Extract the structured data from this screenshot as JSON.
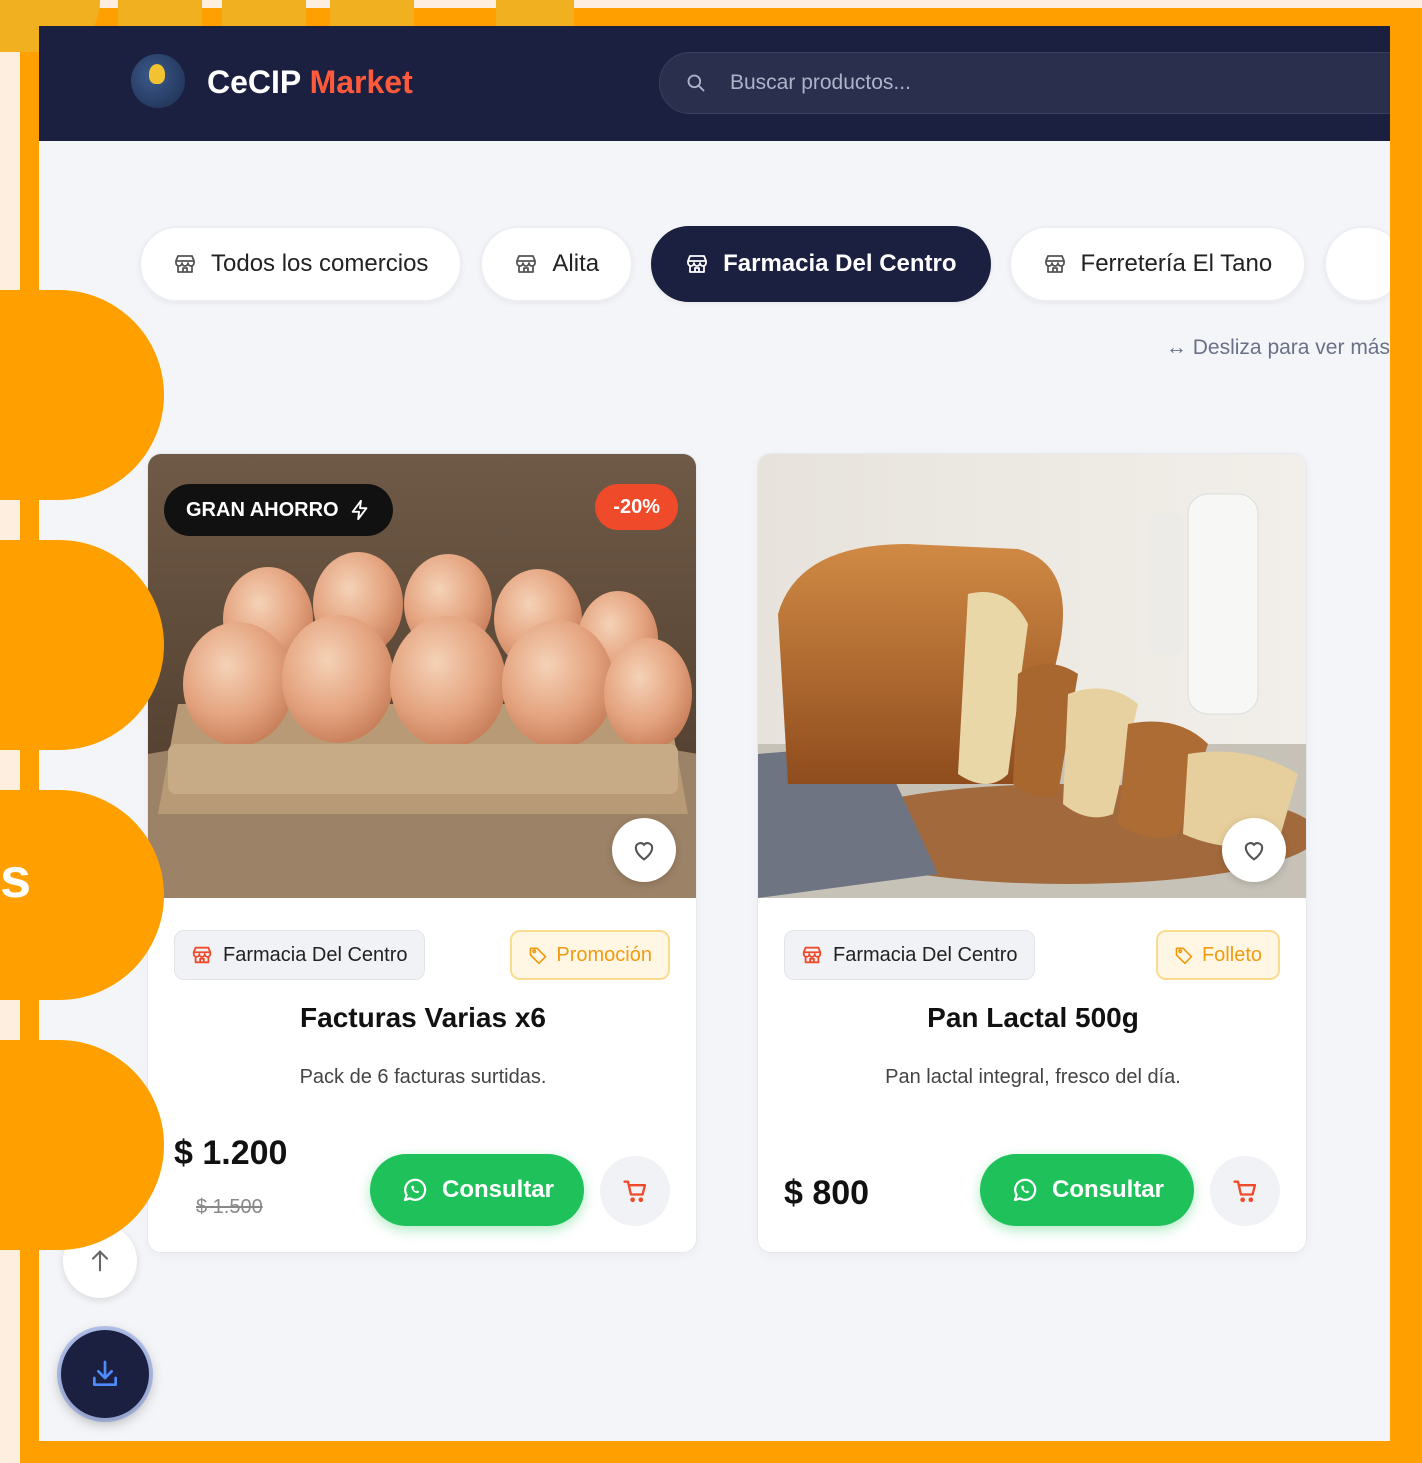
{
  "header": {
    "brand_primary": "CeCIP",
    "brand_accent": "Market",
    "search_placeholder": "Buscar productos..."
  },
  "side_letter": "s",
  "chips": [
    {
      "label": "Todos los comercios",
      "active": false
    },
    {
      "label": "Alita",
      "active": false
    },
    {
      "label": "Farmacia Del Centro",
      "active": true
    },
    {
      "label": "Ferretería El Tano",
      "active": false
    }
  ],
  "scroll_hint": "↔ Desliza para ver más",
  "products": [
    {
      "badge": "GRAN AHORRO",
      "discount": "-20%",
      "store": "Farmacia Del Centro",
      "type": "Promoción",
      "title": "Facturas Varias x6",
      "description": "Pack de 6 facturas surtidas.",
      "price": "$ 1.200",
      "old_price": "$ 1.500",
      "consult_label": "Consultar"
    },
    {
      "store": "Farmacia Del Centro",
      "type": "Folleto",
      "title": "Pan Lactal 500g",
      "description": "Pan lactal integral, fresco del día.",
      "price": "$ 800",
      "consult_label": "Consultar"
    }
  ],
  "colors": {
    "frame": "#ffa000",
    "header_bg": "#1b2040",
    "brand_accent": "#ff5a3c",
    "whatsapp_green": "#1fc25a",
    "discount_red": "#ef4a2a",
    "tag_orange": "#f29a10"
  },
  "icons": [
    "search-icon",
    "store-icon",
    "tag-icon",
    "heart-icon",
    "whatsapp-icon",
    "cart-icon",
    "arrow-up-icon",
    "download-icon",
    "lightning-icon"
  ]
}
